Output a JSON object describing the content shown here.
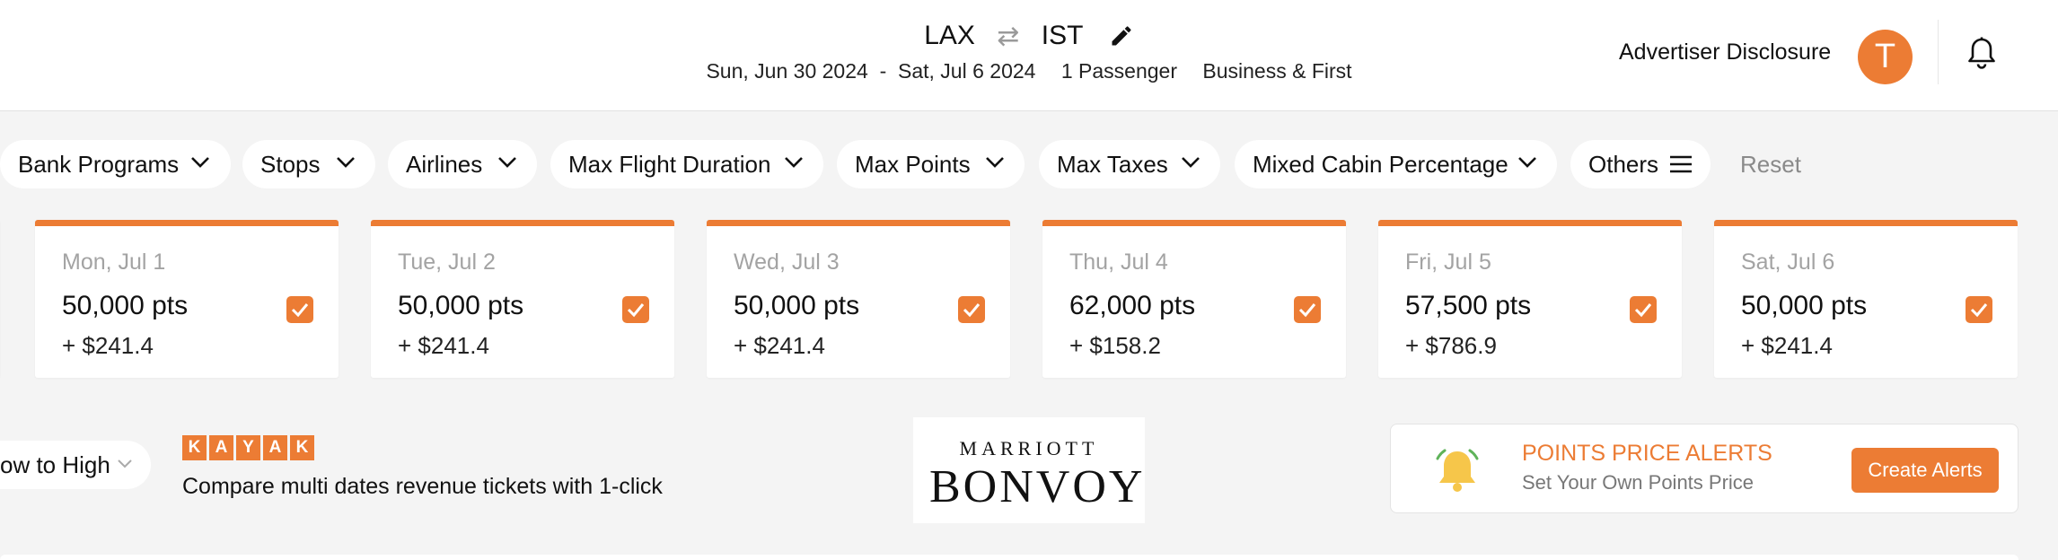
{
  "header": {
    "origin": "LAX",
    "destination": "IST",
    "swap_icon": "swap-arrows-icon",
    "edit_icon": "pencil-icon",
    "dates": "Sun, Jun 30 2024  -  Sat, Jul 6 2024",
    "passengers": "1 Passenger",
    "cabin": "Business & First",
    "advertiser_label": "Advertiser Disclosure",
    "avatar_initial": "T",
    "notification_icon": "bell-icon",
    "accent_color": "#ec7c34"
  },
  "filters": {
    "items": [
      {
        "label": "Bank Programs"
      },
      {
        "label": "Stops"
      },
      {
        "label": "Airlines"
      },
      {
        "label": "Max Flight Duration"
      },
      {
        "label": "Max Points"
      },
      {
        "label": "Max Taxes"
      },
      {
        "label": "Mixed Cabin Percentage"
      },
      {
        "label": "Others"
      }
    ],
    "reset_label": "Reset"
  },
  "dates": [
    {
      "date": "Mon, Jul 1",
      "points": "50,000 pts",
      "taxes": "+ $241.4",
      "checked": true
    },
    {
      "date": "Tue, Jul 2",
      "points": "50,000 pts",
      "taxes": "+ $241.4",
      "checked": true
    },
    {
      "date": "Wed, Jul 3",
      "points": "50,000 pts",
      "taxes": "+ $241.4",
      "checked": true
    },
    {
      "date": "Thu, Jul 4",
      "points": "62,000 pts",
      "taxes": "+ $158.2",
      "checked": true
    },
    {
      "date": "Fri, Jul 5",
      "points": "57,500 pts",
      "taxes": "+ $786.9",
      "checked": true
    },
    {
      "date": "Sat, Jul 6",
      "points": "50,000 pts",
      "taxes": "+ $241.4",
      "checked": true
    }
  ],
  "toolbar": {
    "sort_label": "ow to High",
    "kayak_letters": [
      "K",
      "A",
      "Y",
      "A",
      "K"
    ],
    "kayak_text": "Compare multi dates revenue tickets with 1-click",
    "marriott_top": "MARRIOTT",
    "marriott_bottom": "BONVOY",
    "alert_title": "POINTS PRICE ALERTS",
    "alert_subtitle": "Set Your Own Points Price",
    "alert_button": "Create Alerts"
  }
}
